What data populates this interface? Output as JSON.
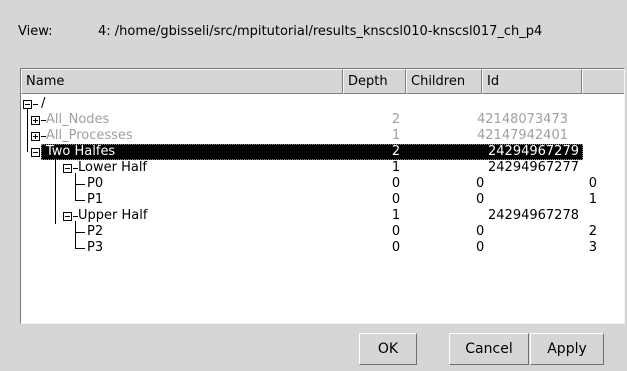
{
  "view": {
    "label": "View:",
    "path": "4: /home/gbisseli/src/mpitutorial/results_knscsl010-knscsl017_ch_p4"
  },
  "table": {
    "columns": [
      "Name",
      "Depth",
      "Children",
      "Id"
    ],
    "rows": [
      {
        "name": "/",
        "depth": "",
        "children": "",
        "id": ""
      },
      {
        "name": "All_Nodes",
        "depth": "2",
        "children": "",
        "id": "42148073473"
      },
      {
        "name": "All_Processes",
        "depth": "1",
        "children": "",
        "id": "42147942401"
      },
      {
        "name": "Two Halfes",
        "depth": "2",
        "children": "",
        "id": "24294967279"
      },
      {
        "name": "Lower Half",
        "depth": "1",
        "children": "",
        "id": "24294967277"
      },
      {
        "name": "P0",
        "depth": "0",
        "children": "0",
        "id": "0"
      },
      {
        "name": "P1",
        "depth": "0",
        "children": "0",
        "id": "1"
      },
      {
        "name": "Upper Half",
        "depth": "1",
        "children": "",
        "id": "24294967278"
      },
      {
        "name": "P2",
        "depth": "0",
        "children": "0",
        "id": "2"
      },
      {
        "name": "P3",
        "depth": "0",
        "children": "0",
        "id": "3"
      }
    ]
  },
  "buttons": {
    "ok": "OK",
    "cancel": "Cancel",
    "apply": "Apply"
  }
}
